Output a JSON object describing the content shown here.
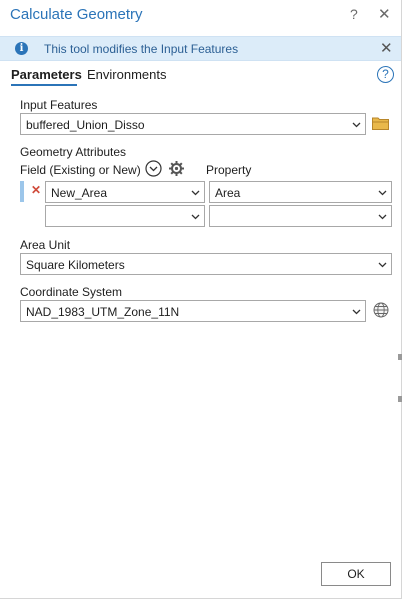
{
  "window": {
    "title": "Calculate Geometry",
    "help_glyph": "?",
    "close_glyph": "✕"
  },
  "banner": {
    "info_glyph": "i",
    "text": "This tool modifies the Input Features",
    "close_glyph": "✕"
  },
  "tabs": [
    {
      "label": "Parameters",
      "active": true
    },
    {
      "label": "Environments",
      "active": false
    }
  ],
  "help_glyph": "?",
  "input_features": {
    "label": "Input Features",
    "value": "buffered_Union_Disso"
  },
  "geometry_attributes": {
    "label": "Geometry Attributes",
    "field_header": "Field (Existing or New)",
    "property_header": "Property",
    "rows": [
      {
        "remove_glyph": "✕",
        "field": "New_Area",
        "property": "Area"
      },
      {
        "field": "",
        "property": ""
      }
    ]
  },
  "area_unit": {
    "label": "Area Unit",
    "value": "Square Kilometers"
  },
  "coordinate_system": {
    "label": "Coordinate System",
    "value": "NAD_1983_UTM_Zone_11N"
  },
  "ok_button": {
    "label": "OK"
  },
  "colors": {
    "accent": "#2b74b8",
    "banner_bg": "#dcecf9",
    "remove": "#d04a3a",
    "folder": "#e9b84a"
  },
  "icons": [
    "info-icon",
    "folder-icon",
    "chevron-down-icon",
    "gear-icon",
    "globe-icon",
    "help-icon",
    "close-icon"
  ]
}
